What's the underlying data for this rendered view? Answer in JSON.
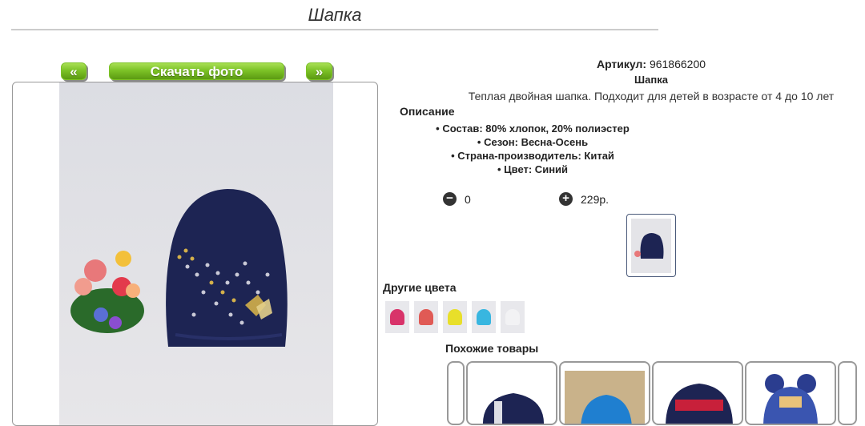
{
  "page": {
    "title": "Шапка"
  },
  "gallery": {
    "prev_label": "«",
    "download_label": "Скачать фото",
    "next_label": "»"
  },
  "product": {
    "article_label": "Артикул:",
    "article_value": "961866200",
    "name": "Шапка",
    "short_description": "Теплая двойная шапка. Подходит для детей в возрасте от 4 до 10 лет",
    "description_heading": "Описание",
    "specs": [
      "Состав: 80% хлопок, 20% полиэстер",
      "Сезон: Весна-Осень",
      "Страна-производитель: Китай",
      "Цвет: Синий"
    ]
  },
  "cart": {
    "minus_icon": "minus-circle-icon",
    "quantity": "0",
    "plus_icon": "plus-circle-icon",
    "price": "229р."
  },
  "other_colors": {
    "heading": "Другие цвета",
    "swatch_colors": [
      "#d8336a",
      "#e05a55",
      "#e8df2a",
      "#38b6e0",
      "#f2f2f4"
    ]
  },
  "similar": {
    "heading": "Похожие товары"
  },
  "colors": {
    "button_green": "#7cc227",
    "hat_navy": "#1d2453"
  }
}
